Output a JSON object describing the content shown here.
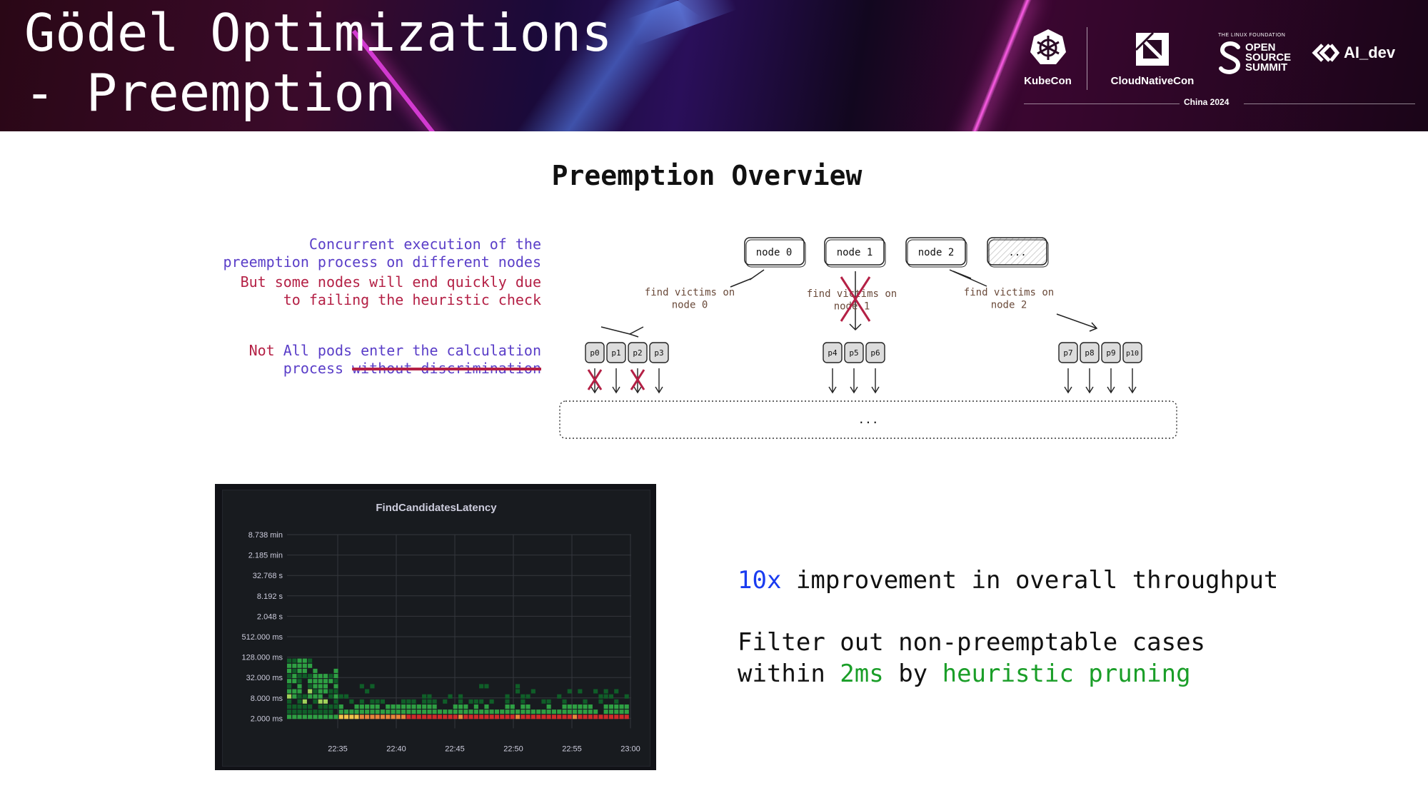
{
  "header": {
    "title": "Gödel Optimizations\n- Preemption",
    "logos": {
      "kubecon": "KubeCon",
      "cloudnativecon": "CloudNativeCon",
      "linux_foundation": "THE LINUX FOUNDATION",
      "open_source_summit": [
        "OPEN",
        "SOURCE",
        "SUMMIT"
      ],
      "ai_dev": "AI_dev",
      "event": "China 2024"
    }
  },
  "overview": {
    "title": "Preemption Overview",
    "notes": {
      "concurrent": "Concurrent execution of the\npreemption process on different nodes",
      "failing": "But some nodes will end quickly due\nto failing the heuristic check",
      "not_prefix": "Not",
      "calc_main": " All pods enter the calculation",
      "calc_second": "process ",
      "calc_struck": "without discrimination"
    },
    "diagram": {
      "nodes": [
        "node 0",
        "node 1",
        "node 2",
        "..."
      ],
      "edge_labels": [
        "find victims on\nnode 0",
        "find victims on\nnode 1",
        "find victims on\nnode 2"
      ],
      "pod_groups": [
        [
          "p0",
          "p1",
          "p2",
          "p3"
        ],
        [
          "p4",
          "p5",
          "p6"
        ],
        [
          "p7",
          "p8",
          "p9",
          "p10"
        ]
      ],
      "eliminated": [
        "node 1",
        "p0",
        "p2"
      ],
      "bottom_label": "...",
      "accent_color": "#b42045"
    }
  },
  "heatmap_panel": {
    "title": "FindCandidatesLatency",
    "y_ticks": [
      "8.738 min",
      "2.185 min",
      "32.768 s",
      "8.192 s",
      "2.048 s",
      "512.000 ms",
      "128.000 ms",
      "32.000 ms",
      "8.000 ms",
      "2.000 ms"
    ],
    "x_ticks": [
      "22:35",
      "22:40",
      "22:45",
      "22:50",
      "22:55",
      "23:00"
    ],
    "colors": {
      "low": "#0f5e28",
      "mid": "#2ea043",
      "high": "#f2c34a",
      "hot": "#d12a2a",
      "bg": "#181b1f"
    }
  },
  "stats": {
    "improvement_highlight": "10x",
    "improvement_rest": " improvement in overall throughput",
    "filter_line1": "Filter out non-preemptable cases",
    "filter_within": "within ",
    "filter_time": "2ms",
    "filter_by": " by ",
    "filter_method": "heuristic pruning"
  }
}
